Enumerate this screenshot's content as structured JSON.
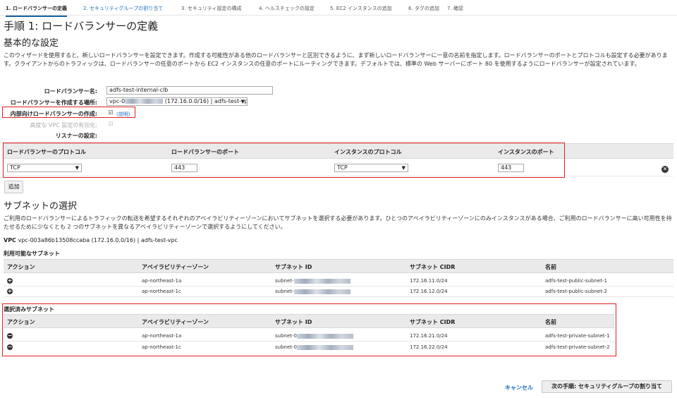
{
  "steps": [
    {
      "label": "1. ロードバランサーの定義"
    },
    {
      "label": "2. セキュリティグループの割り当て"
    },
    {
      "label": "3. セキュリティ設定の構成"
    },
    {
      "label": "4. ヘルスチェックの設定"
    },
    {
      "label": "5. EC2 インスタンスの追加"
    },
    {
      "label": "6. タグの追加"
    },
    {
      "label": "7. 確認"
    }
  ],
  "page_title": "手順 1: ロードバランサーの定義",
  "basic": {
    "heading": "基本的な設定",
    "description": "このウィザードを使用すると、新しいロードバランサーを設定できます。作成する可能性がある他のロードバランサーと区別できるように、まず新しいロードバランサーに一意の名前を指定します。ロードバランサーのポートとプロトコルも設定する必要があります。クライアントからのトラフィックは、ロードバランサーの任意のポートから EC2 インスタンスの任意のポートにルーティングできます。デフォルトでは、標準の Web サーバーにポート 80 を使用するようにロードバランサーが設定されています。",
    "name_label": "ロードバランサー名:",
    "name_value": "adfs-test-internal-clb",
    "location_label": "ロードバランサーを作成する場所:",
    "location_prefix": "vpc-0",
    "location_suffix": "(172.16.0.0/16) | adfs-test-vpc",
    "internal_label": "内部向けロードバランサーの作成:",
    "internal_link": "(説明)",
    "advanced_vpc_label": "高度な VPC 設定の有効化:",
    "listener_label": "リスナーの設定:"
  },
  "listener_table": {
    "headers": [
      "ロードバランサーのプロトコル",
      "ロードバランサーのポート",
      "インスタンスのプロトコル",
      "インスタンスのポート"
    ],
    "row": {
      "lb_protocol": "TCP",
      "lb_port": "443",
      "instance_protocol": "TCP",
      "instance_port": "443"
    },
    "add_button": "追加"
  },
  "subnets": {
    "heading": "サブネットの選択",
    "description": "ご利用のロードバランサーによるトラフィックの転送を希望するそれぞれのアベイラビリティーゾーンにおいてサブネットを選択する必要があります。ひとつのアベイラビリティーゾーンにのみインスタンスがある場合、ご利用のロードバランサーに高い可用性を持たせるために少なくとも 2 つのサブネットを異なるアベイラビリティーゾーンで選択するようにしてください。",
    "vpc_label": "VPC",
    "vpc_value": "vpc-003a86b13508ccaba (172.16.0.0/16) | adfs-test-vpc",
    "headers": [
      "アクション",
      "アベイラビリティーゾーン",
      "サブネット ID",
      "サブネット CIDR",
      "名前"
    ],
    "available_title": "利用可能なサブネット",
    "available": [
      {
        "az": "ap-northeast-1a",
        "subnet_prefix": "subnet-",
        "cidr": "172.16.11.0/24",
        "name": "adfs-test-public-subnet-1"
      },
      {
        "az": "ap-northeast-1c",
        "subnet_prefix": "subnet-",
        "cidr": "172.16.12.0/24",
        "name": "adfs-test-public-subnet-2"
      }
    ],
    "selected_title": "選択済みサブネット",
    "selected": [
      {
        "az": "ap-northeast-1a",
        "subnet_prefix": "subnet-0",
        "cidr": "172.16.21.0/24",
        "name": "adfs-test-private-subnet-1"
      },
      {
        "az": "ap-northeast-1c",
        "subnet_prefix": "subnet-0",
        "cidr": "172.16.22.0/24",
        "name": "adfs-test-private-subnet-2"
      }
    ]
  },
  "footer": {
    "cancel": "キャンセル",
    "next": "次の手順: セキュリティグループの割り当て"
  },
  "colors": {
    "highlight_box": "#e02020",
    "link": "#1a6fbf",
    "active_step_underline": "#1a5fa0"
  }
}
